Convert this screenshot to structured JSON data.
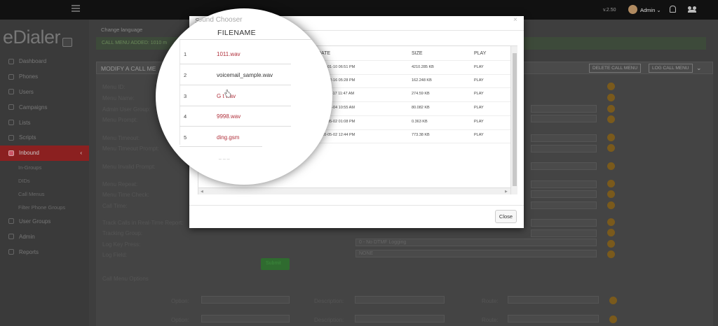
{
  "topbar": {
    "version": "v.2.50",
    "user": "Admin",
    "user_caret": "⌄"
  },
  "sidebar": {
    "logo": "eDialer",
    "logo_box": "ff",
    "items": [
      {
        "label": "Dashboard"
      },
      {
        "label": "Phones"
      },
      {
        "label": "Users"
      },
      {
        "label": "Campaigns"
      },
      {
        "label": "Lists"
      },
      {
        "label": "Scripts"
      },
      {
        "label": "Inbound",
        "active": true
      },
      {
        "label": "In-Groups",
        "sub": true
      },
      {
        "label": "DIDs",
        "sub": true
      },
      {
        "label": "Call Menus",
        "sub": true
      },
      {
        "label": "Filter Phone Groups",
        "sub": true
      },
      {
        "label": "User Groups"
      },
      {
        "label": "Admin"
      },
      {
        "label": "Reports"
      }
    ],
    "chevron": "‹"
  },
  "main": {
    "change_language": "Change language",
    "success": "CALL MENU ADDED: 1010 m",
    "panel_title": "MODIFY A CALL ME",
    "delete_button": "DELETE CALL MENU",
    "log_button": "LOG CALL MENU",
    "collapse": "⌄",
    "form_labels": [
      "Menu ID:",
      "Menu Name:",
      "Admin User Group:",
      "Menu Prompt:",
      "Menu Timeout:",
      "Menu Timeout Prompt:",
      "Menu Invalid Prompt:",
      "Menu Repeat:",
      "Menu Time Check:",
      "Call Time:",
      "Track Calls in Real-Time Report:",
      "Tracking Group:",
      "Log Key Press:",
      "Log Field:"
    ],
    "log_key_press_value": "0 - No DTMF Logging",
    "log_field_value": "NONE",
    "submit": "Submit",
    "call_menu_options": "Call Menu Options",
    "option_label": "Option:",
    "description_label": "Description:",
    "route_label": "Route:"
  },
  "modal": {
    "title": "Sound Chooser",
    "close_x": "×",
    "close_button": "Close",
    "columns": [
      "FILENAME",
      "DATE",
      "SIZE",
      "PLAY"
    ],
    "rows": [
      {
        "num": "1",
        "filename": "1011.wav",
        "date": "2021-01-10 06:51 PM",
        "size": "4210.285 KB",
        "play": "PLAY"
      },
      {
        "num": "2",
        "filename": "voicemail_sample.wav",
        "date": "2020-12-16 05:28 PM",
        "size": "162.248 KB",
        "play": "PLAY"
      },
      {
        "num": "3",
        "filename": "G t wav",
        "date": "2020-11-17 11:47 AM",
        "size": "274.59 KB",
        "play": "PLAY"
      },
      {
        "num": "4",
        "filename": "9998.wav",
        "date": "2020-05-04 10:55 AM",
        "size": "80.082 KB",
        "play": "PLAY"
      },
      {
        "num": "5",
        "filename": "ding.gsm",
        "date": "2020-05-02 01:08 PM",
        "size": "0.363 KB",
        "play": "PLAY"
      },
      {
        "num": "",
        "filename": "",
        "date": "2020-05-02 12:44 PM",
        "size": "773.38 KB",
        "play": "PLAY"
      }
    ],
    "lens_tail": "_ _ _"
  },
  "colors": {
    "active_nav": "#8b2020",
    "filename_red": "#b0303b",
    "help_icon": "#7a5a1c"
  }
}
